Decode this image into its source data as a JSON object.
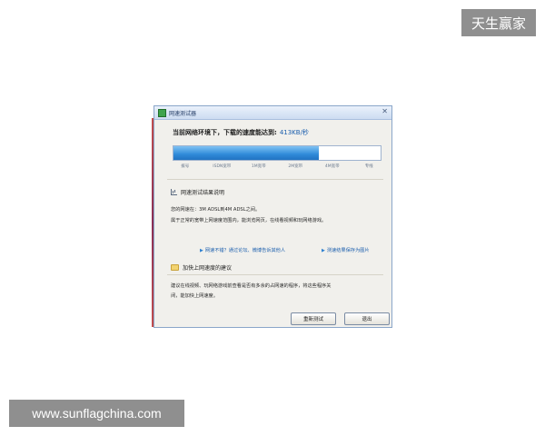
{
  "watermarks": {
    "brand": "天生赢家",
    "url": "www.sunflagchina.com"
  },
  "window": {
    "title": "网速测试器",
    "headline_prefix": "当前网络环境下，下载的速度能达到:",
    "speed": "413KB/秒",
    "progress_fraction": 0.7,
    "scale_labels": [
      "拨号",
      "ISDN宽带",
      "1M宽带",
      "2M宽带",
      "4M宽带",
      "专线"
    ],
    "section1_title": "网速测试结果说明",
    "result_line1": "您的网速在：3M ADSL到4M ADSL之间。",
    "result_line2": "属于正常的宽带上网速度范围内，能浏览网页，在线看视频和玩网络游戏。",
    "link_share": "网速不错？通过论坛、微博告诉其他人",
    "link_save": "测速结果保存为图片",
    "section2_title": "加快上网速度的建议",
    "advice_line1": "建议在线视频、玩网络游戏前查看是否有多余的占网速的程序，将这些程序关",
    "advice_line2": "闭，能加快上网速度。",
    "retest_button": "重新测试",
    "exit_button": "退出"
  },
  "colors": {
    "progress_fill": "#2f8ad8",
    "link": "#1c5fae",
    "watermark_bg": "#8f8f8f"
  }
}
